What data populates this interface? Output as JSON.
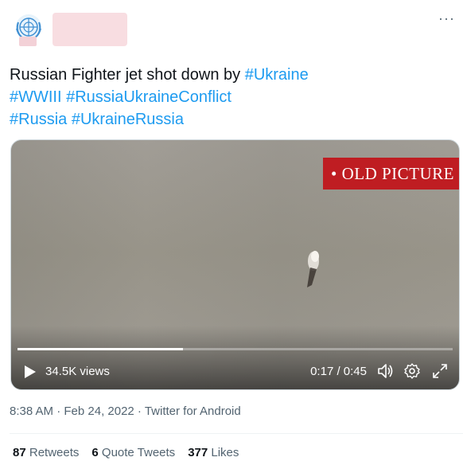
{
  "header": {
    "more_label": "···",
    "icon": "more-horizontal-icon"
  },
  "tweet": {
    "text_lines": [
      [
        {
          "text": "Russian Fighter jet shot down by ",
          "tag": false
        },
        {
          "text": "#Ukraine",
          "tag": true
        }
      ],
      [
        {
          "text": "#WWIII",
          "tag": true
        },
        {
          "text": " ",
          "tag": false
        },
        {
          "text": "#RussiaUkraineConflict",
          "tag": true
        }
      ],
      [
        {
          "text": "#Russia",
          "tag": true
        },
        {
          "text": " ",
          "tag": false
        },
        {
          "text": "#UkraineRussia",
          "tag": true
        }
      ]
    ]
  },
  "media": {
    "stamp": "• OLD PICTURE",
    "views": "34.5K views",
    "time": "0:17 / 0:45",
    "progress": 0.38,
    "icons": [
      "play-icon",
      "volume-icon",
      "settings-icon",
      "fullscreen-icon"
    ]
  },
  "meta": {
    "timestamp": "8:38 AM · Feb 24, 2022 · Twitter for Android"
  },
  "stats": [
    {
      "count": "87",
      "label": " Retweets"
    },
    {
      "count": "6",
      "label": " Quote Tweets"
    },
    {
      "count": "377",
      "label": " Likes"
    }
  ],
  "colors": {
    "link": "#1d9bf0",
    "stamp_bg": "#bf1d22",
    "secondary_text": "#536471",
    "name_redaction": "#f8dde1"
  }
}
